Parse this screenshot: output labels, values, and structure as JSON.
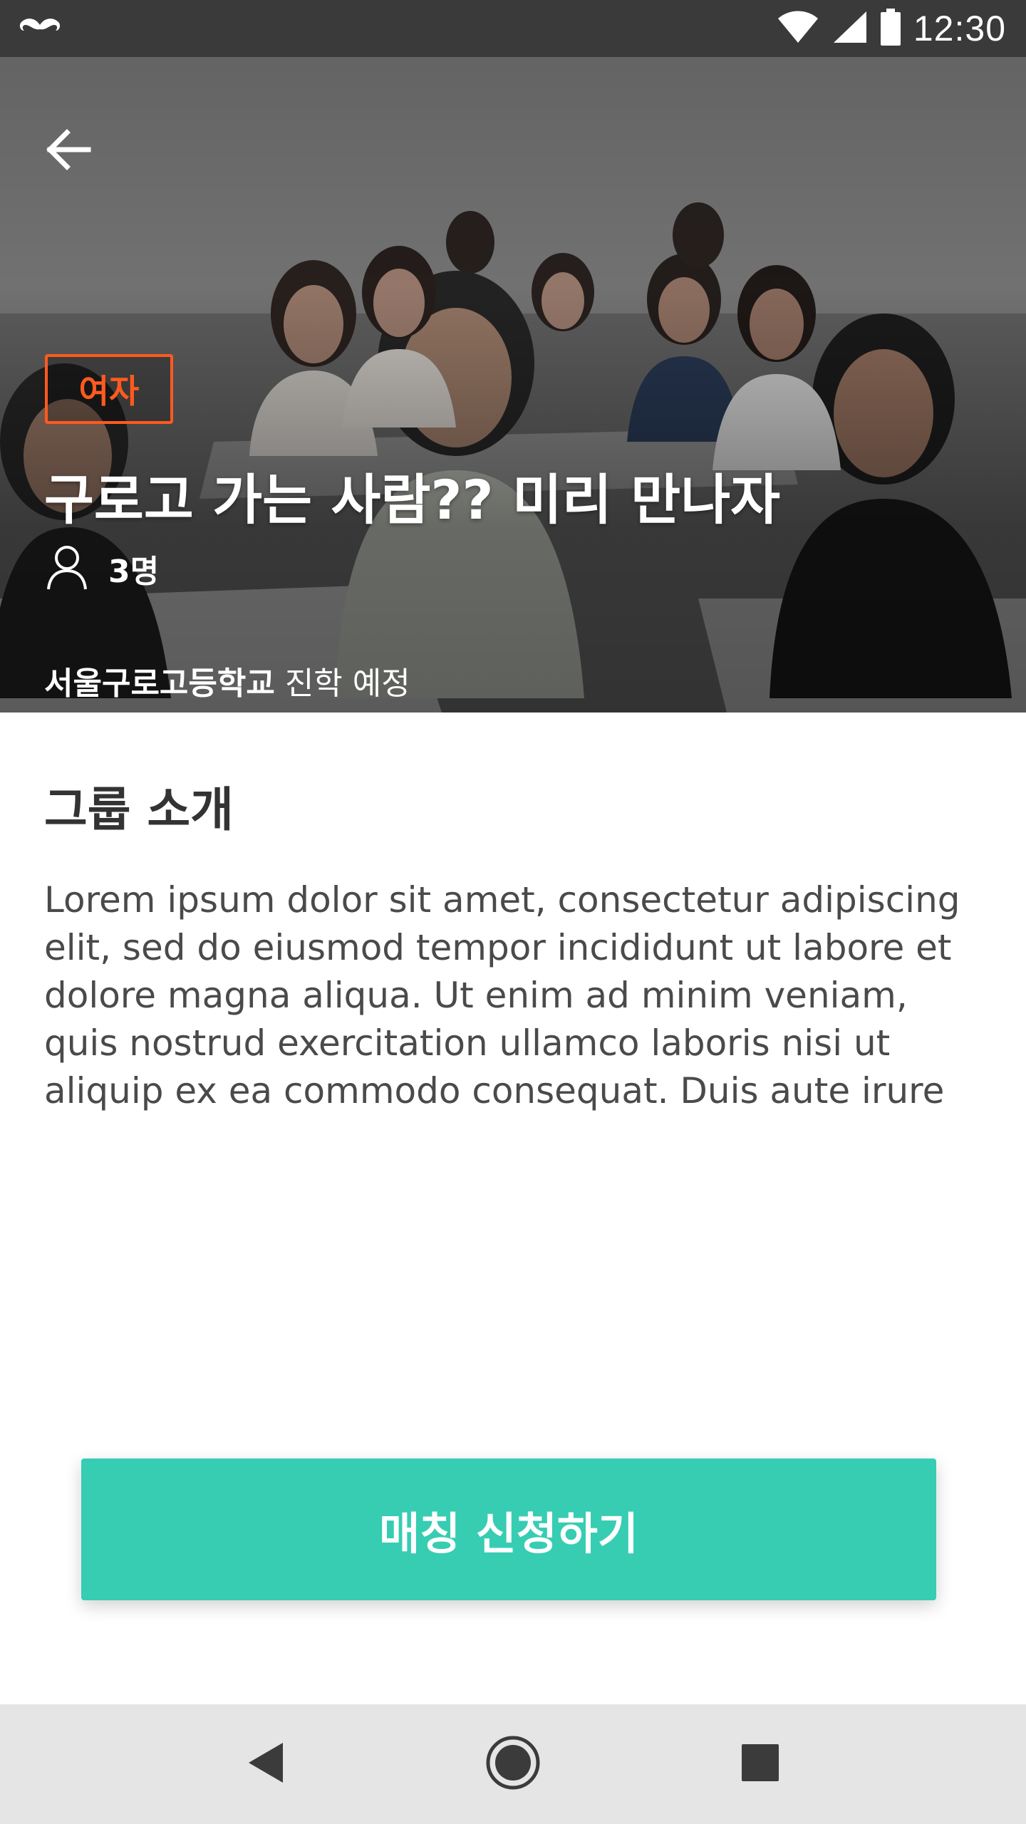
{
  "status_bar": {
    "time": "12:30",
    "icons": [
      "mustache-icon",
      "wifi-icon",
      "signal-icon",
      "battery-icon"
    ]
  },
  "hero": {
    "back_icon": "arrow-left-icon",
    "tag": "여자",
    "title": "구로고 가는 사람?? 미리 만나자",
    "member_icon": "person-icon",
    "member_count": "3명",
    "school_name": "서울구로고등학교",
    "school_suffix": " 진학 예정"
  },
  "content": {
    "section_title": "그룹 소개",
    "intro": "Lorem ipsum dolor sit amet, consectetur adipiscing elit, sed do eiusmod tempor incididunt ut labore et dolore magna aliqua. Ut enim ad minim veniam, quis nostrud exercitation ullamco laboris nisi ut aliquip ex ea commodo consequat. Duis aute irure"
  },
  "cta": {
    "label": "매칭 신청하기"
  },
  "colors": {
    "accent": "#36cdb3",
    "tag": "#ff5a1f",
    "status_bar": "#3a3a3a",
    "nav_bar": "#e5e5e5"
  },
  "nav_bar": {
    "icons": [
      "back-triangle-icon",
      "home-circle-icon",
      "recents-square-icon"
    ]
  }
}
